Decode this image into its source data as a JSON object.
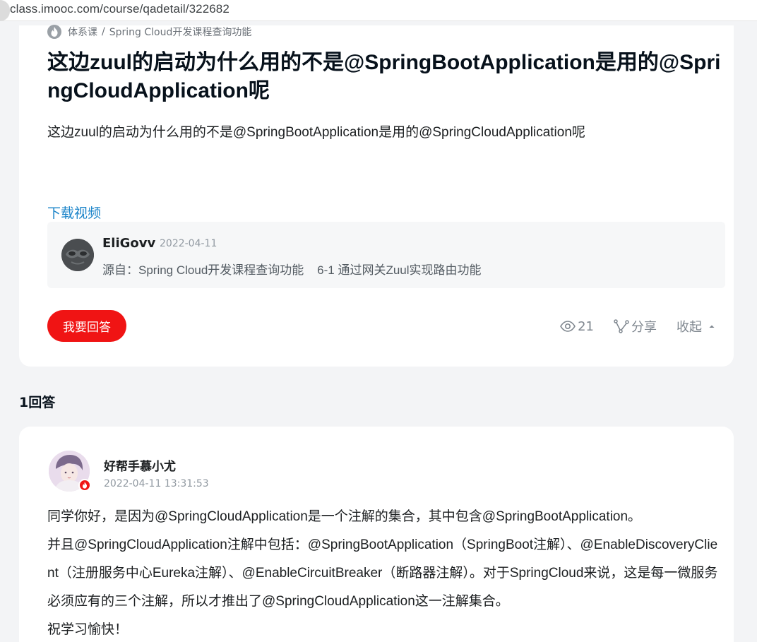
{
  "browser": {
    "url": "class.imooc.com/course/qadetail/322682"
  },
  "breadcrumb": {
    "root": "体系课",
    "separator": "/",
    "course": "Spring Cloud开发课程查询功能"
  },
  "question": {
    "title": "这边zuul的启动为什么用的不是@SpringBootApplication是用的@SpringCloudApplication呢",
    "body": "这边zuul的启动为什么用的不是@SpringBootApplication是用的@SpringCloudApplication呢",
    "download_link": "下载视频"
  },
  "source": {
    "author": "EliGovv",
    "date": "2022-04-11",
    "from": "源自：Spring Cloud开发课程查询功能    6-1 通过网关Zuul实现路由功能"
  },
  "actions": {
    "answer_button": "我要回答",
    "views": "21",
    "share": "分享",
    "collapse": "收起"
  },
  "answers_header": "1回答",
  "answer": {
    "author": "好帮手慕小尤",
    "time": "2022-04-11 13:31:53",
    "paragraphs": [
      "同学你好，是因为@SpringCloudApplication是一个注解的集合，其中包含@SpringBootApplication。",
      "并且@SpringCloudApplication注解中包括：@SpringBootApplication（SpringBoot注解）、@EnableDiscoveryClient（注册服务中心Eureka注解）、@EnableCircuitBreaker（断路器注解）。对于SpringCloud来说，这是每一微服务必须应有的三个注解，所以才推出了@SpringCloudApplication这一注解集合。",
      "祝学习愉快！"
    ]
  },
  "colors": {
    "accent_red": "#f01414",
    "link_blue": "#1b84c9",
    "page_bg": "#f3f4f6",
    "muted_text": "#9199a1"
  },
  "icons": {
    "breadcrumb": "flame-icon",
    "views": "eye-icon",
    "share": "share-icon",
    "collapse": "caret-up-icon"
  }
}
